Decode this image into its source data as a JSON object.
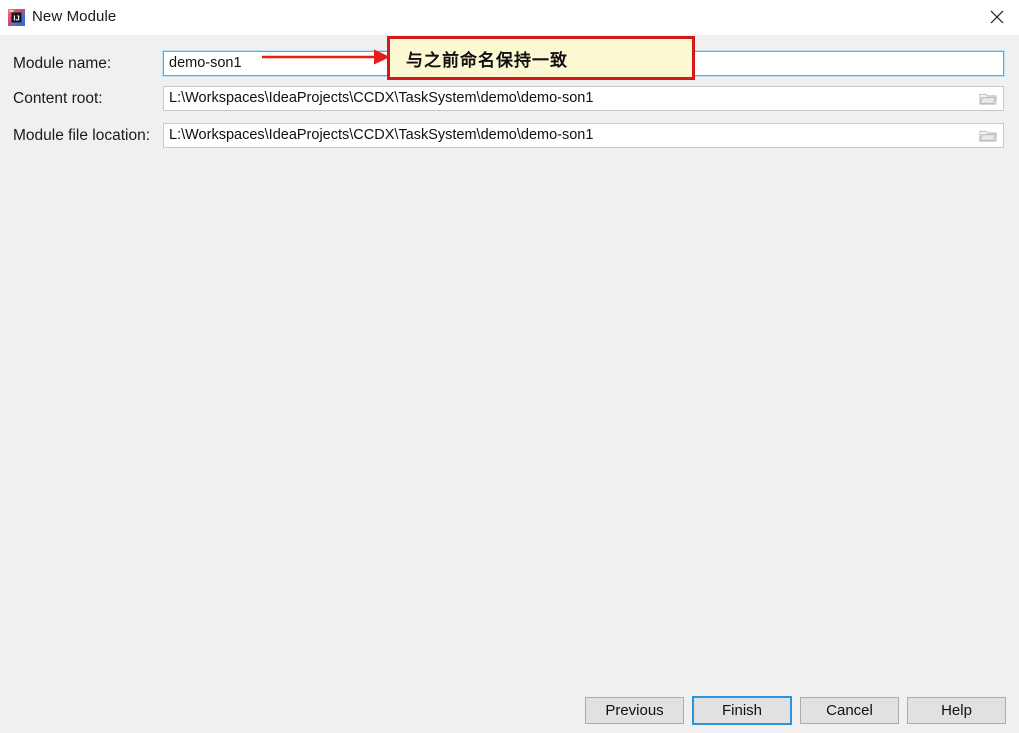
{
  "window": {
    "title": "New Module",
    "app_icon": "intellij-idea-icon",
    "close_icon": "close-icon"
  },
  "form": {
    "fields": [
      {
        "label": "Module name:",
        "value": "demo-son1",
        "placeholder": "",
        "focused": true,
        "has_browse": false
      },
      {
        "label": "Content root:",
        "value": "L:\\Workspaces\\IdeaProjects\\CCDX\\TaskSystem\\demo\\demo-son1",
        "placeholder": "",
        "focused": false,
        "has_browse": true,
        "browse_icon": "folder-icon"
      },
      {
        "label": "Module file location:",
        "value": "L:\\Workspaces\\IdeaProjects\\CCDX\\TaskSystem\\demo\\demo-son1",
        "placeholder": "",
        "focused": false,
        "has_browse": true,
        "browse_icon": "folder-icon"
      }
    ]
  },
  "annotation": {
    "arrow_icon": "red-arrow-icon",
    "callout_text": "与之前命名保持一致",
    "callout_bg": "#fcf8d2",
    "callout_border": "#d31919",
    "arrow_color": "#e81d16"
  },
  "buttons": {
    "previous": "Previous",
    "finish": "Finish",
    "cancel": "Cancel",
    "help": "Help",
    "default_button": "Finish",
    "focus_color": "#2e93d8"
  }
}
